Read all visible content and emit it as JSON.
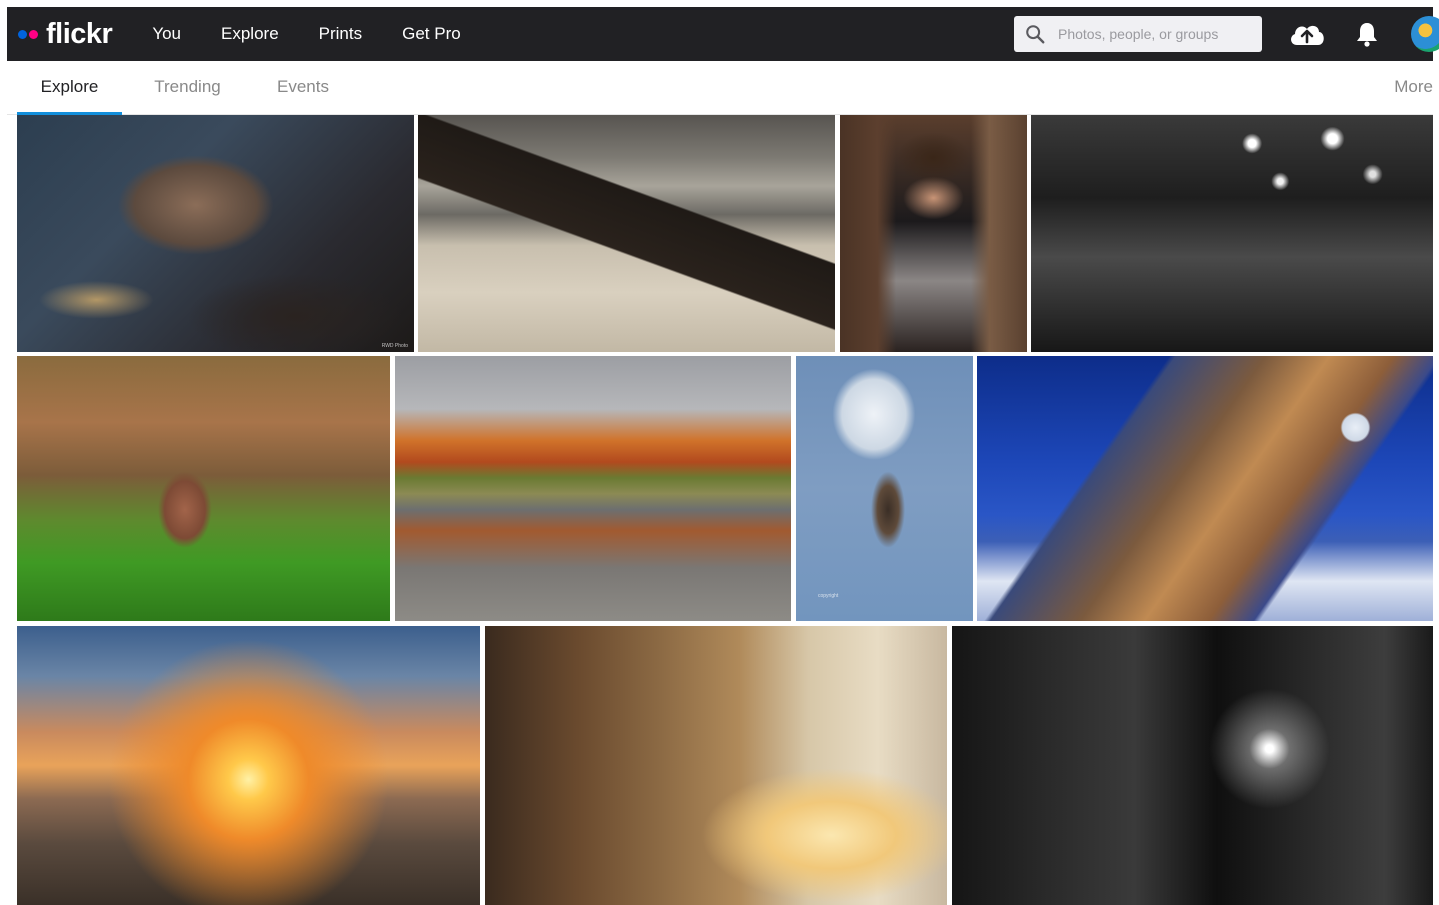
{
  "topbar": {
    "logo_text": "flickr",
    "nav": [
      "You",
      "Explore",
      "Prints",
      "Get Pro"
    ],
    "search_placeholder": "Photos, people, or groups"
  },
  "subnav": {
    "tabs": [
      "Explore",
      "Trending",
      "Events"
    ],
    "active_tab": "Explore",
    "more_label": "More"
  },
  "photos": [
    {
      "id": "bug",
      "subject": "isopod macro",
      "credit": "RWD Photo"
    },
    {
      "id": "beach",
      "subject": "beach with rocks"
    },
    {
      "id": "woman",
      "subject": "woman portrait"
    },
    {
      "id": "street",
      "subject": "rainy street at night"
    },
    {
      "id": "squirrel",
      "subject": "red squirrel"
    },
    {
      "id": "lake",
      "subject": "autumn lake"
    },
    {
      "id": "hawk",
      "subject": "hawk and moon",
      "credit": "copyright"
    },
    {
      "id": "mountain",
      "subject": "mountain peak with moon"
    },
    {
      "id": "sunset",
      "subject": "sunset through bare tree"
    },
    {
      "id": "forest",
      "subject": "misty forest sunrise"
    },
    {
      "id": "alley",
      "subject": "dark alley at night"
    }
  ],
  "colors": {
    "topbar_bg": "#212124",
    "accent_blue": "#0063dc",
    "accent_pink": "#ff0084",
    "active_tab_underline": "#128fdc"
  }
}
